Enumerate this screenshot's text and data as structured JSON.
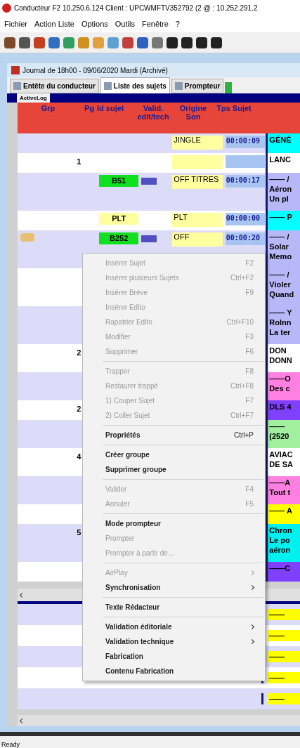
{
  "window": {
    "title": "Conducteur F2 10.250.6.124 Client : UPCWMFTV352792 (2 @ : 10.252.291.2"
  },
  "menu_bar": [
    "Fichier",
    "Action Liste",
    "Options",
    "Outils",
    "Fenêtre",
    "?"
  ],
  "document": {
    "title": "Journal de 18h00 - 09/06/2020 Mardi (Archivé)"
  },
  "tabs": [
    {
      "label": "Entête du conducteur",
      "selected": false
    },
    {
      "label": "Liste des sujets",
      "selected": true
    },
    {
      "label": "Prompteur",
      "selected": false
    }
  ],
  "sub_tab": "ActiveLog",
  "table": {
    "columns": [
      "Grp",
      "Pg",
      "Id sujet",
      "Valid. edit/tech",
      "Origine Son",
      "Tps Sujet"
    ],
    "rows": [
      {
        "grp_marker": false,
        "pg": "",
        "id": "",
        "valid_icon": false,
        "origine": "JINGLE",
        "tps": "00:00:09",
        "sujet": [
          "GÉNÉ"
        ],
        "color": "#00ffff"
      },
      {
        "grp_marker": false,
        "pg": "1",
        "id": "",
        "valid_icon": false,
        "origine": "",
        "tps": "",
        "sujet": [
          "LANC"
        ]
      },
      {
        "grp_marker": false,
        "pg": "",
        "id": {
          "text": "B51",
          "color": "#10e020"
        },
        "valid_icon": true,
        "origine": "OFF TITRES",
        "tps": "00:00:17",
        "sujet": [
          "—— /",
          "Aéron",
          "Un pl"
        ],
        "color": "#b8b8f8"
      },
      {
        "grp_marker": false,
        "pg": "",
        "id": {
          "text": "PLT",
          "color": "#ffffa0"
        },
        "valid_icon": false,
        "origine": "PLT",
        "tps": "00:00:00",
        "sujet": [
          "—— P"
        ],
        "color": "#00ffff"
      },
      {
        "grp_marker": true,
        "pg": "",
        "id": {
          "text": "B252",
          "color": "#10e020"
        },
        "valid_icon": true,
        "origine": "OFF",
        "tps": "00:00:20",
        "sujet": [
          "—— /",
          "Solar",
          "Memo"
        ],
        "color": "#b8b8f8"
      },
      {
        "grp_marker": false,
        "pg": "",
        "id": "",
        "valid_icon": false,
        "origine": "",
        "tps": "",
        "sujet": [
          "—— /",
          "Violer",
          "Quand"
        ],
        "color": "#b8b8f8"
      },
      {
        "grp_marker": false,
        "pg": "",
        "id": "",
        "valid_icon": false,
        "origine": "",
        "tps": "",
        "sujet": [
          "—— Y",
          "Rolnn",
          "La ter"
        ],
        "color": "#b8b8f8"
      },
      {
        "grp_marker": false,
        "pg": "2",
        "id": "",
        "valid_icon": false,
        "origine": "",
        "tps": "",
        "sujet": [
          "DON",
          "DONN"
        ]
      },
      {
        "grp_marker": false,
        "pg": "",
        "id": "",
        "valid_icon": false,
        "origine": "",
        "tps": "",
        "sujet": [
          "——O",
          "Des c"
        ],
        "color": "#ff80e0"
      },
      {
        "grp_marker": false,
        "pg": "2",
        "id": "",
        "valid_icon": false,
        "origine": "",
        "tps": "",
        "sujet": [
          "DLS 4"
        ],
        "color": "#8040ff"
      },
      {
        "grp_marker": false,
        "pg": "",
        "id": "",
        "valid_icon": false,
        "origine": "",
        "tps": "",
        "sujet": [
          "——",
          "(2520"
        ],
        "color": "#a0f0a0"
      },
      {
        "grp_marker": false,
        "pg": "4",
        "id": "",
        "valid_icon": false,
        "origine": "",
        "tps": "",
        "sujet": [
          "AVIAC",
          "DE SA"
        ]
      },
      {
        "grp_marker": false,
        "pg": "",
        "id": "",
        "valid_icon": false,
        "origine": "",
        "tps": "",
        "sujet": [
          "——A",
          "Tout t"
        ],
        "color": "#ff80e0"
      },
      {
        "grp_marker": false,
        "pg": "",
        "id": "",
        "valid_icon": false,
        "origine": "",
        "tps": "",
        "sujet": [
          "—— A"
        ],
        "color": "#ffff00"
      },
      {
        "grp_marker": false,
        "pg": "5",
        "id": "",
        "valid_icon": false,
        "origine": "",
        "tps": "",
        "sujet": [
          "Chron",
          "Le po",
          "aéron"
        ],
        "color": "#00f0f0"
      },
      {
        "grp_marker": false,
        "pg": "",
        "id": "",
        "valid_icon": false,
        "origine": "",
        "tps": "",
        "sujet": [
          "——C"
        ],
        "color": "#8040ff"
      }
    ]
  },
  "lower_table": {
    "rows": [
      {
        "sujet": "——",
        "color": "#ffff00"
      },
      {
        "sujet": "——",
        "color": "#ffff00"
      },
      {
        "sujet": "——",
        "color": "#ffff00"
      },
      {
        "sujet": "——",
        "color": "#ffff00"
      },
      {
        "sujet": "——",
        "color": "#ffff00"
      }
    ]
  },
  "context_menu": [
    {
      "kind": "item",
      "label": "Insérer Sujet",
      "shortcut": "F2",
      "disabled": true
    },
    {
      "kind": "item",
      "label": "Insérer plusieurs Sujets",
      "shortcut": "Ctrl+F2",
      "disabled": true
    },
    {
      "kind": "item",
      "label": "Insérer Brève",
      "shortcut": "F9",
      "disabled": true
    },
    {
      "kind": "item",
      "label": "Insérer Edito",
      "disabled": true
    },
    {
      "kind": "item",
      "label": "Rapatrier Edito",
      "shortcut": "Ctrl+F10",
      "disabled": true
    },
    {
      "kind": "item",
      "label": "Modifier",
      "shortcut": "F3",
      "disabled": true
    },
    {
      "kind": "item",
      "label": "Supprimer",
      "shortcut": "F6",
      "disabled": true
    },
    {
      "kind": "separator"
    },
    {
      "kind": "item",
      "label": "Trapper",
      "shortcut": "F8",
      "disabled": true
    },
    {
      "kind": "item",
      "label": "Restaurer trappé",
      "shortcut": "Ctrl+F8",
      "disabled": true
    },
    {
      "kind": "item",
      "label": "1) Couper Sujet",
      "shortcut": "F7",
      "disabled": true
    },
    {
      "kind": "item",
      "label": "2) Coller Sujet",
      "shortcut": "Ctrl+F7",
      "disabled": true
    },
    {
      "kind": "separator"
    },
    {
      "kind": "item",
      "label": "Propriétés",
      "shortcut": "Ctrl+P",
      "disabled": false
    },
    {
      "kind": "separator"
    },
    {
      "kind": "item",
      "label": "Créer groupe",
      "disabled": false
    },
    {
      "kind": "item",
      "label": "Supprimer groupe",
      "disabled": false
    },
    {
      "kind": "separator"
    },
    {
      "kind": "item",
      "label": "Valider",
      "shortcut": "F4",
      "disabled": true
    },
    {
      "kind": "item",
      "label": "Annuler",
      "shortcut": "F5",
      "disabled": true
    },
    {
      "kind": "separator"
    },
    {
      "kind": "item",
      "label": "Mode prompteur",
      "disabled": false
    },
    {
      "kind": "item",
      "label": "Prompter",
      "disabled": true
    },
    {
      "kind": "item",
      "label": "Prompter à partir de...",
      "disabled": true
    },
    {
      "kind": "separator"
    },
    {
      "kind": "submenu",
      "label": "AirPlay",
      "disabled": true
    },
    {
      "kind": "submenu",
      "label": "Synchronisation",
      "disabled": false
    },
    {
      "kind": "separator"
    },
    {
      "kind": "item",
      "label": "Texte Rédacteur",
      "disabled": false
    },
    {
      "kind": "separator"
    },
    {
      "kind": "submenu",
      "label": "Validation éditoriale",
      "disabled": false
    },
    {
      "kind": "submenu",
      "label": "Validation technique",
      "disabled": false
    },
    {
      "kind": "item",
      "label": "Fabrication",
      "disabled": false
    },
    {
      "kind": "item",
      "label": "Contenu Fabrication",
      "disabled": false
    }
  ],
  "status_bar": "Ready"
}
